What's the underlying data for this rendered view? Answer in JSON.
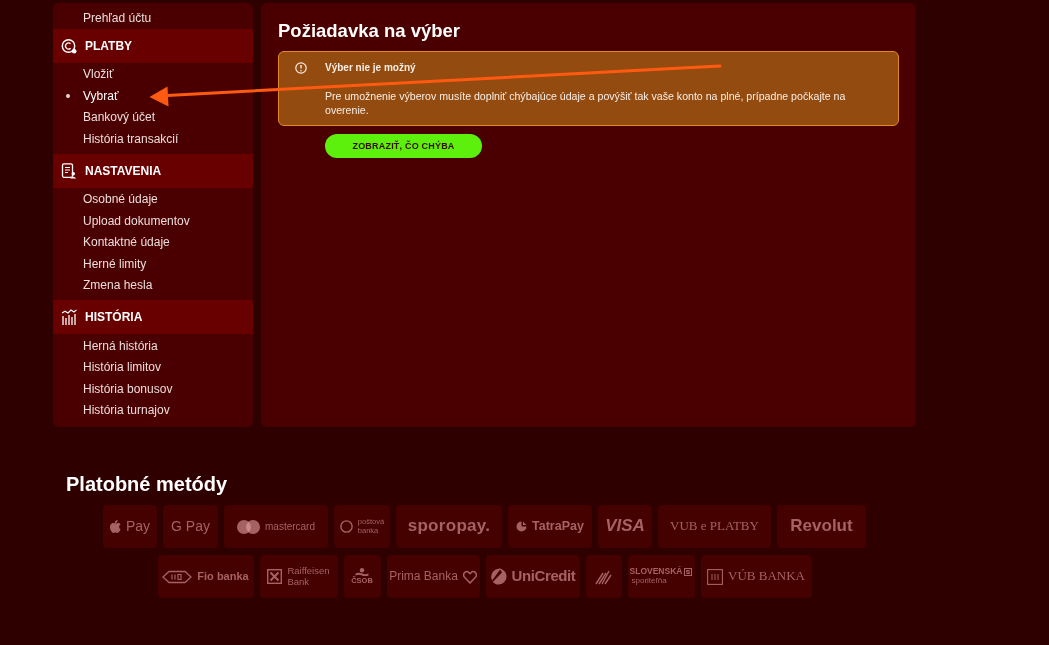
{
  "sidebar": {
    "items": [
      {
        "label": "Prehľad účtu",
        "selected": false
      }
    ],
    "sections": [
      {
        "title": "PLATBY",
        "kind": "coin",
        "items": [
          {
            "label": "Vložiť",
            "selected": false
          },
          {
            "label": "Vybrať",
            "selected": true
          },
          {
            "label": "Bankový účet",
            "selected": false
          },
          {
            "label": "História transakcií",
            "selected": false
          }
        ]
      },
      {
        "title": "NASTAVENIA",
        "kind": "document",
        "items": [
          {
            "label": "Osobné údaje",
            "selected": false
          },
          {
            "label": "Upload dokumentov",
            "selected": false
          },
          {
            "label": "Kontaktné údaje",
            "selected": false
          },
          {
            "label": "Herné limity",
            "selected": false
          },
          {
            "label": "Zmena hesla",
            "selected": false
          }
        ]
      },
      {
        "title": "HISTÓRIA",
        "kind": "chart",
        "items": [
          {
            "label": "Herná história",
            "selected": false
          },
          {
            "label": "História limitov",
            "selected": false
          },
          {
            "label": "História bonusov",
            "selected": false
          },
          {
            "label": "História turnajov",
            "selected": false
          }
        ]
      }
    ]
  },
  "main": {
    "title": "Požiadavka na výber",
    "alert": {
      "title": "Výber nie je možný",
      "message": "Pre umožnenie výberov musíte doplniť chýbajúce údaje a povýšiť tak vaše konto na plné, prípadne počkajte na overenie."
    },
    "button": "ZOBRAZIŤ, ČO CHÝBA"
  },
  "payment_methods": {
    "title": "Platobné metódy",
    "methods": [
      {
        "kind": "apple",
        "label": "Pay"
      },
      {
        "kind": "gpay",
        "label": "G Pay"
      },
      {
        "kind": "mastercard",
        "label": "mastercard"
      },
      {
        "kind": "ring",
        "label": "poštová",
        "sublabel": "banka"
      },
      {
        "kind": "sporopay",
        "label": "sporopay."
      },
      {
        "kind": "tatra",
        "label": "TatraPay"
      },
      {
        "kind": "visa",
        "label": "VISA"
      },
      {
        "kind": "vubplatby",
        "label": "VUB e PLATBY"
      },
      {
        "kind": "revolut",
        "label": "Revolut"
      },
      {
        "kind": "fio",
        "label": "Fio banka"
      },
      {
        "kind": "raiffeisen",
        "label": "Raiffeisen",
        "sublabel": "Bank"
      },
      {
        "kind": "csob",
        "label": "ČSOB"
      },
      {
        "kind": "prima",
        "label": "Prima Banka"
      },
      {
        "kind": "unicredit",
        "label": "UniCredit"
      },
      {
        "kind": "stripes"
      },
      {
        "kind": "slsp",
        "label": "SLOVENSKÁ",
        "sublabel": "sporiteľňa"
      },
      {
        "kind": "vubbanka",
        "label": "VÚB BANKA"
      }
    ]
  }
}
